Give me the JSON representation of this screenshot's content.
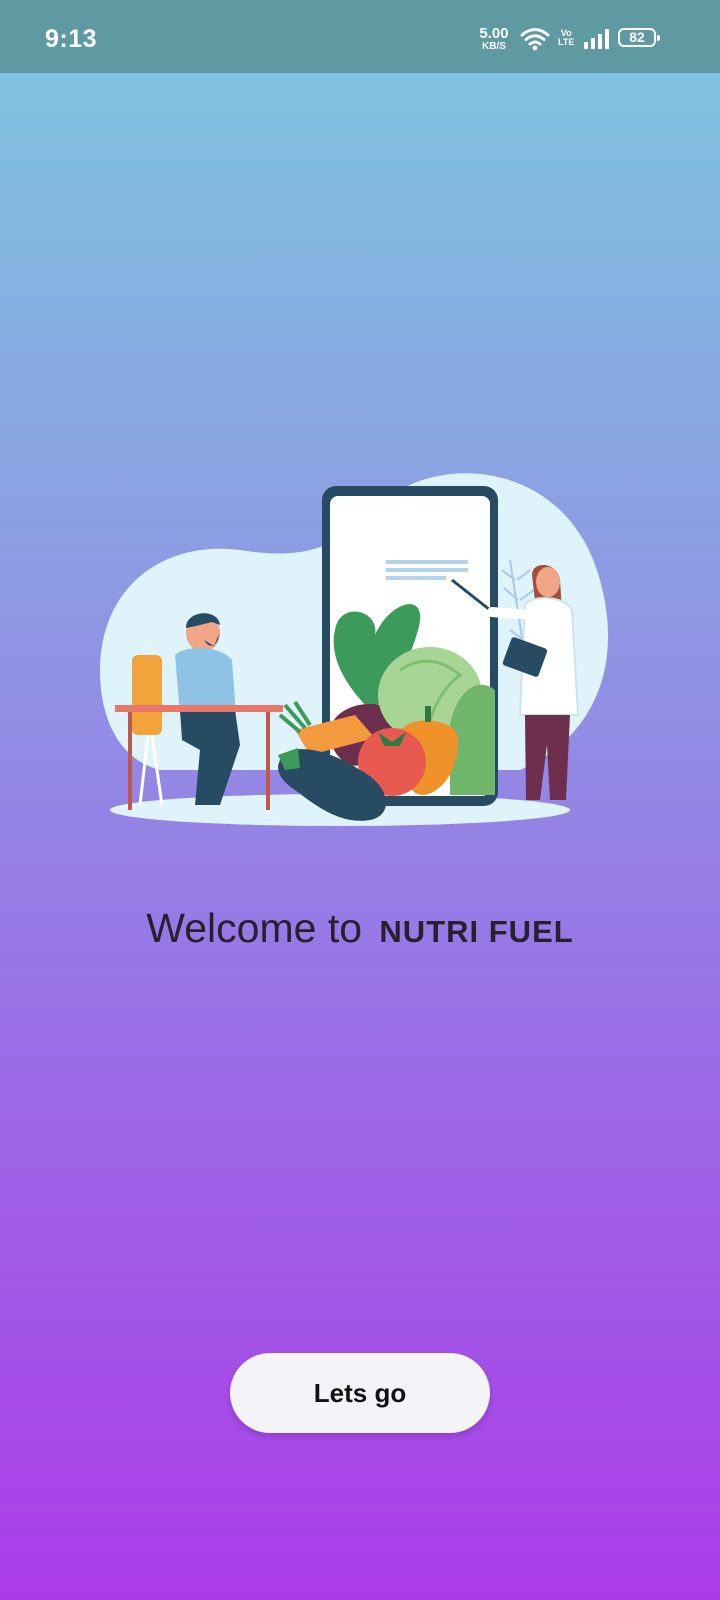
{
  "status_bar": {
    "time": "9:13",
    "net_speed_value": "5.00",
    "net_speed_unit": "KB/S",
    "volte_top": "Vo",
    "volte_bottom": "LTE",
    "battery_level": "82"
  },
  "welcome": {
    "prefix": "Welcome to",
    "brand": "NUTRI FUEL"
  },
  "cta": {
    "label": "Lets go"
  },
  "icons": [
    "wifi-icon",
    "volte-icon",
    "signal-icon",
    "battery-icon"
  ],
  "colors": {
    "status_bar_bg": "#5f9aa3",
    "gradient_top": "#7ec8de",
    "gradient_bottom": "#ab3be9",
    "button_bg": "#f3f3f8"
  }
}
